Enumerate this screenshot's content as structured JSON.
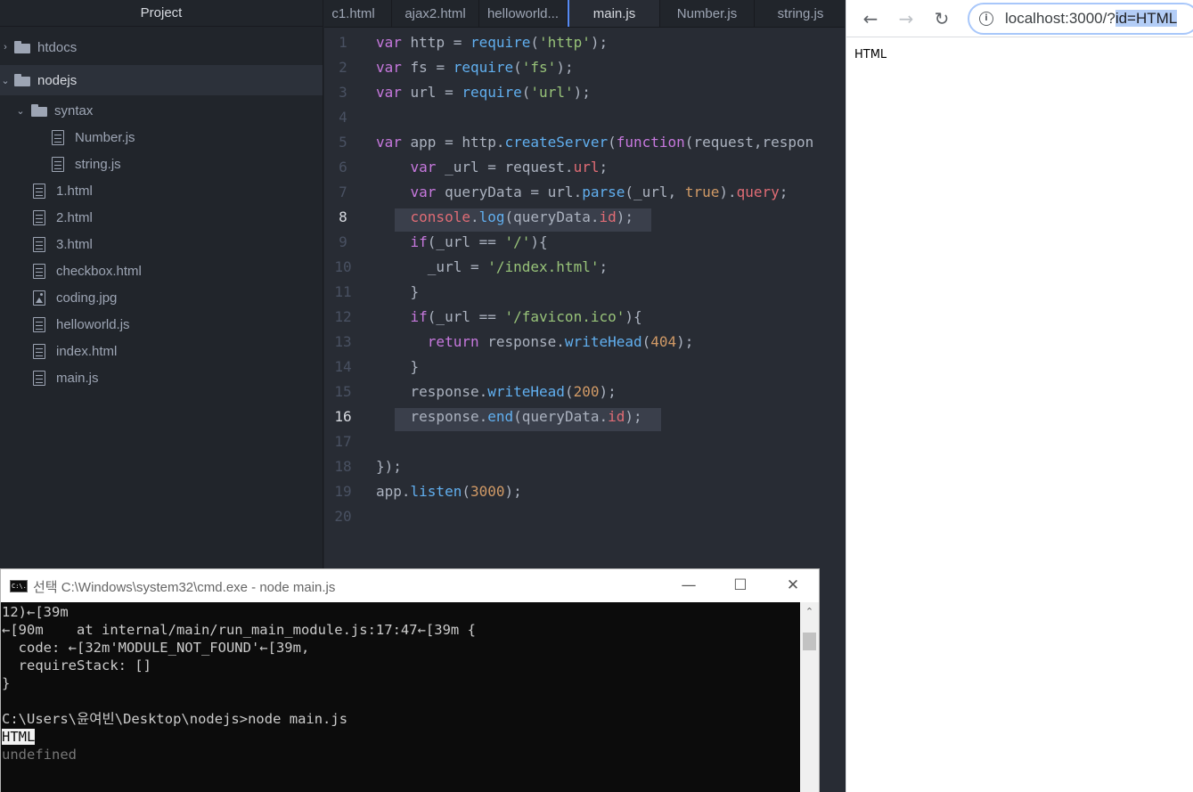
{
  "sidebar": {
    "title": "Project",
    "items": [
      {
        "label": "htdocs"
      },
      {
        "label": "nodejs"
      },
      {
        "label": "syntax"
      },
      {
        "label": "Number.js"
      },
      {
        "label": "string.js"
      },
      {
        "label": "1.html"
      },
      {
        "label": "2.html"
      },
      {
        "label": "3.html"
      },
      {
        "label": "checkbox.html"
      },
      {
        "label": "coding.jpg"
      },
      {
        "label": "helloworld.js"
      },
      {
        "label": "index.html"
      },
      {
        "label": "main.js"
      }
    ]
  },
  "tabs": [
    {
      "label": "1.html",
      "display": "c1.html"
    },
    {
      "label": "ajax2.html"
    },
    {
      "label": "helloworld..."
    },
    {
      "label": "main.js",
      "active": true
    },
    {
      "label": "Number.js"
    },
    {
      "label": "string.js"
    }
  ],
  "editor": {
    "line_numbers": [
      "1",
      "2",
      "3",
      "4",
      "5",
      "6",
      "7",
      "8",
      "9",
      "10",
      "11",
      "12",
      "13",
      "14",
      "15",
      "16",
      "17",
      "18",
      "19",
      "20"
    ],
    "lines": [
      "var http = require('http');",
      "var fs = require('fs');",
      "var url = require('url');",
      "",
      "var app = http.createServer(function(request,respon",
      "    var _url = request.url;",
      "    var queryData = url.parse(_url, true).query;",
      "    console.log(queryData.id);",
      "    if(_url == '/'){",
      "      _url = '/index.html';",
      "    }",
      "    if(_url == '/favicon.ico'){",
      "      return response.writeHead(404);",
      "    }",
      "    response.writeHead(200);",
      "    response.end(queryData.id);",
      "",
      "});",
      "app.listen(3000);",
      ""
    ],
    "highlighted_lines": [
      8,
      16
    ]
  },
  "browser": {
    "back_icon": "←",
    "forward_icon": "→",
    "reload_icon": "↻",
    "info_icon": "i",
    "url_prefix": "localhost:3000/?",
    "url_selected": "id=HTML",
    "page_text": "HTML"
  },
  "cmd": {
    "icon_text": "C:\\.",
    "title": "선택 C:\\Windows\\system32\\cmd.exe - node  main.js",
    "minimize_icon": "—",
    "maximize_icon": "☐",
    "close_icon": "✕",
    "scroll_up_icon": "⌃",
    "lines": [
      "12)←[39m",
      "←[90m    at internal/main/run_main_module.js:17:47←[39m {",
      "  code: ←[32m'MODULE_NOT_FOUND'←[39m,",
      "  requireStack: []",
      "}",
      "",
      "C:\\Users\\윤여빈\\Desktop\\nodejs>node main.js",
      "HTML",
      "undefined"
    ]
  }
}
